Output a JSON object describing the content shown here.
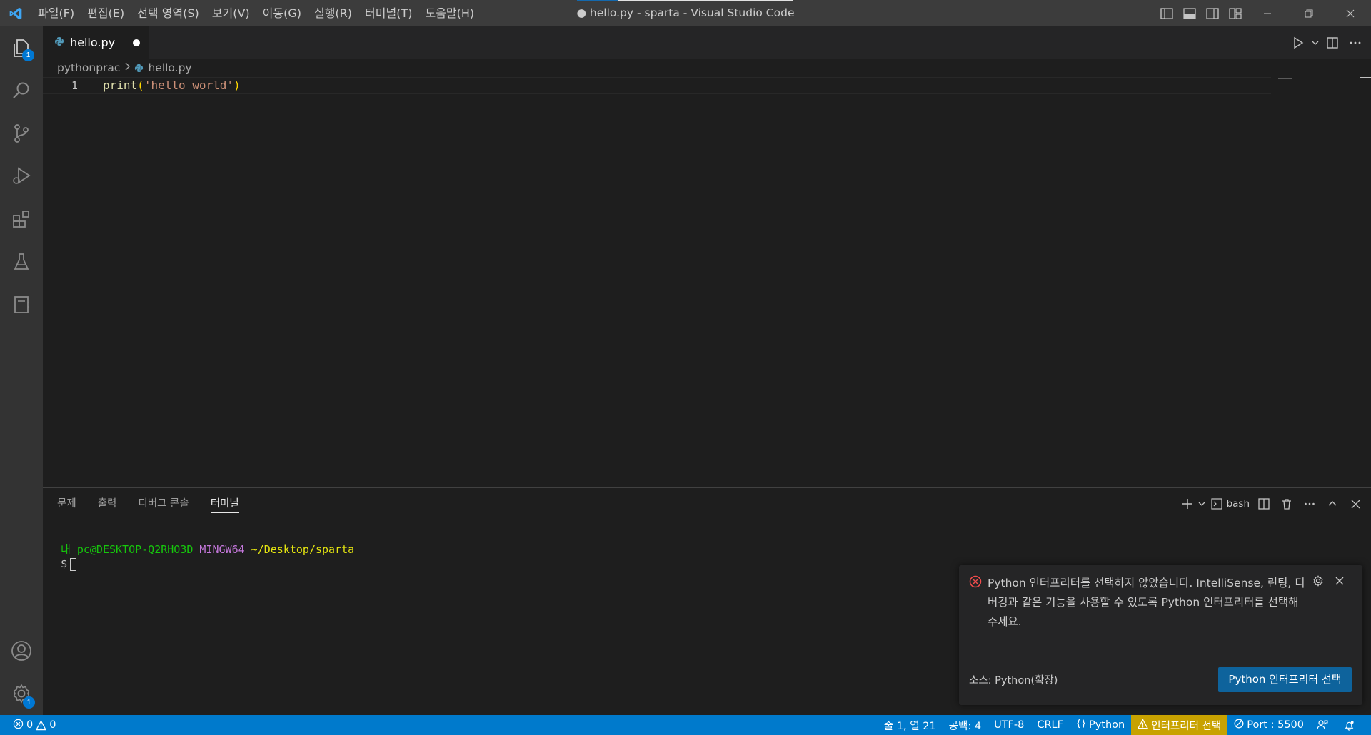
{
  "window": {
    "title": "● hello.py - sparta - Visual Studio Code"
  },
  "menu": [
    {
      "label": "파일(F)"
    },
    {
      "label": "편집(E)"
    },
    {
      "label": "선택 영역(S)"
    },
    {
      "label": "보기(V)"
    },
    {
      "label": "이동(G)"
    },
    {
      "label": "실행(R)"
    },
    {
      "label": "터미널(T)"
    },
    {
      "label": "도움말(H)"
    }
  ],
  "activity": {
    "explorer_badge": "1",
    "settings_badge": "1"
  },
  "editor": {
    "tab": {
      "name": "hello.py"
    },
    "breadcrumb": {
      "folder": "pythonprac",
      "file": "hello.py"
    },
    "lines": [
      {
        "number": "1",
        "fn": "print",
        "open": "(",
        "str": "'hello world'",
        "close": ")"
      }
    ]
  },
  "panel": {
    "tabs": [
      {
        "label": "문제"
      },
      {
        "label": "출력"
      },
      {
        "label": "디버그 콘솔"
      },
      {
        "label": "터미널"
      }
    ],
    "shell": "bash",
    "terminal": {
      "user": "내 pc@DESKTOP-Q2RHO3D",
      "env": "MINGW64",
      "path": "~/Desktop/sparta",
      "prompt": "$"
    }
  },
  "notification": {
    "message": "Python 인터프리터를 선택하지 않았습니다. IntelliSense, 린팅, 디버깅과 같은 기능을 사용할 수 있도록 Python 인터프리터를 선택해 주세요.",
    "source": "소스: Python(확장)",
    "button": "Python 인터프리터 선택"
  },
  "status": {
    "errors": "0",
    "warnings": "0",
    "position": "줄 1, 열 21",
    "spaces": "공백: 4",
    "encoding": "UTF-8",
    "eol": "CRLF",
    "language": "Python",
    "interpreter": "인터프리터 선택",
    "port": "Port : 5500"
  },
  "colors": {
    "accent": "#007acc",
    "warning": "#c8a200",
    "error": "#f14c4c"
  }
}
